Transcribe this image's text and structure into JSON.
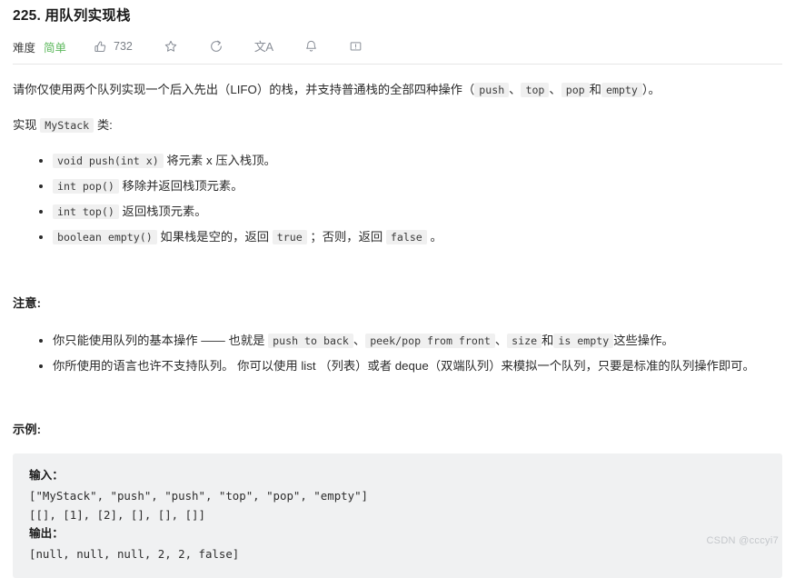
{
  "problem": {
    "title": "225. 用队列实现栈",
    "difficulty_label": "难度",
    "difficulty_value": "简单",
    "difficulty_color": "#5cb85c"
  },
  "actions": {
    "like": {
      "icon": "thumbs-up-icon",
      "count": "732"
    },
    "favorite": {
      "icon": "star-icon"
    },
    "share": {
      "icon": "share-refresh-icon"
    },
    "translate": {
      "icon": "translate-icon",
      "glyph": "文A"
    },
    "notify": {
      "icon": "bell-icon"
    },
    "feedback": {
      "icon": "feedback-icon"
    }
  },
  "description": {
    "intro_p1": "请你仅使用两个队列实现一个后入先出（LIFO）的栈，并支持普通栈的全部四种操作（",
    "intro_code1": "push",
    "intro_sep1": "、",
    "intro_code2": "top",
    "intro_sep2": "、",
    "intro_code3": "pop",
    "intro_mid": "和",
    "intro_code4": "empty",
    "intro_end": "）。",
    "impl_pre": "实现",
    "impl_code": "MyStack",
    "impl_post": "类:"
  },
  "methods": [
    {
      "code": "void push(int x)",
      "text": "将元素 x 压入栈顶。"
    },
    {
      "code": "int pop()",
      "text": "移除并返回栈顶元素。"
    },
    {
      "code": "int top()",
      "text": "返回栈顶元素。"
    },
    {
      "code": "boolean empty()",
      "text_pre": "如果栈是空的，返回",
      "code_true": "true",
      "text_mid": "；否则，返回",
      "code_false": "false",
      "text_post": "。"
    }
  ],
  "notes": {
    "heading": "注意:",
    "item1_pre": "你只能使用队列的基本操作 —— 也就是",
    "item1_code1": "push to back",
    "item1_sep1": "、",
    "item1_code2": "peek/pop from front",
    "item1_sep2": "、",
    "item1_code3": "size",
    "item1_mid": "和",
    "item1_code4": "is empty",
    "item1_post": "这些操作。",
    "item2": "你所使用的语言也许不支持队列。 你可以使用 list （列表）或者 deque（双端队列）来模拟一个队列，只要是标准的队列操作即可。"
  },
  "example": {
    "heading": "示例:",
    "input_label": "输入：",
    "input_line1": "[\"MyStack\", \"push\", \"push\", \"top\", \"pop\", \"empty\"]",
    "input_line2": "[[], [1], [2], [], [], []]",
    "output_label": "输出：",
    "output_line1": "[null, null, null, 2, 2, false]"
  },
  "watermark": "CSDN @cccyi7"
}
